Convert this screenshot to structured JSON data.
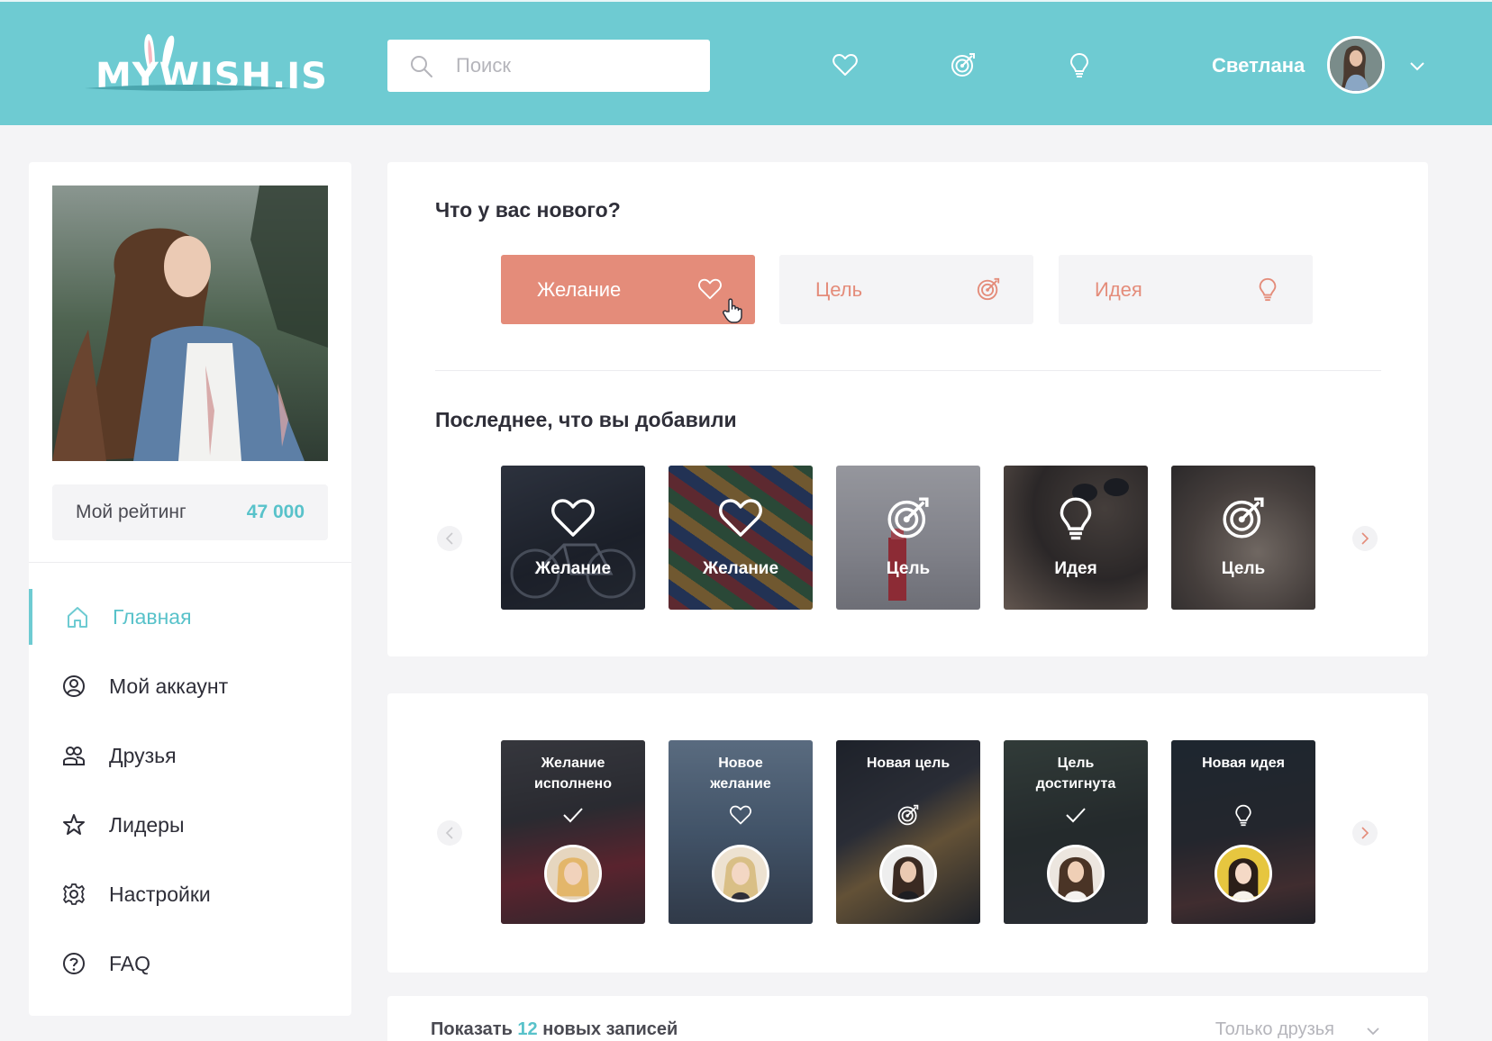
{
  "header": {
    "logo_text": "MYWISH.IS",
    "search_placeholder": "Поиск",
    "icons": [
      "heart-icon",
      "target-icon",
      "lightbulb-icon"
    ],
    "user_name": "Светлана",
    "colors": {
      "bar": "#6ecbd2",
      "accent": "#e48c7a"
    }
  },
  "sidebar": {
    "rating_label": "Мой рейтинг",
    "rating_value": "47 000",
    "nav": [
      {
        "label": "Главная",
        "icon": "home-icon",
        "active": true
      },
      {
        "label": "Мой аккаунт",
        "icon": "account-icon",
        "active": false
      },
      {
        "label": "Друзья",
        "icon": "friends-icon",
        "active": false
      },
      {
        "label": "Лидеры",
        "icon": "star-icon",
        "active": false
      },
      {
        "label": "Настройки",
        "icon": "gear-icon",
        "active": false
      },
      {
        "label": "FAQ",
        "icon": "question-icon",
        "active": false
      }
    ]
  },
  "new_post": {
    "title": "Что у вас нового?",
    "types": [
      {
        "label": "Желание",
        "icon": "heart-icon"
      },
      {
        "label": "Цель",
        "icon": "target-icon"
      },
      {
        "label": "Идея",
        "icon": "lightbulb-icon"
      }
    ]
  },
  "recent": {
    "title": "Последнее, что вы добавили",
    "items": [
      {
        "label": "Желание",
        "icon": "heart-icon"
      },
      {
        "label": "Желание",
        "icon": "heart-icon"
      },
      {
        "label": "Цель",
        "icon": "target-icon"
      },
      {
        "label": "Идея",
        "icon": "lightbulb-icon"
      },
      {
        "label": "Цель",
        "icon": "target-icon"
      }
    ]
  },
  "feed": {
    "items": [
      {
        "title": "Желание исполнено",
        "icon": "check-icon"
      },
      {
        "title": "Новое желание",
        "icon": "heart-icon"
      },
      {
        "title": "Новая цель",
        "icon": "target-icon"
      },
      {
        "title": "Цель достигнута",
        "icon": "check-icon"
      },
      {
        "title": "Новая идея",
        "icon": "lightbulb-icon"
      }
    ]
  },
  "footer_bar": {
    "show_prefix": "Показать",
    "show_count": "12",
    "show_suffix": "новых записей",
    "filter_label": "Только друзья"
  }
}
